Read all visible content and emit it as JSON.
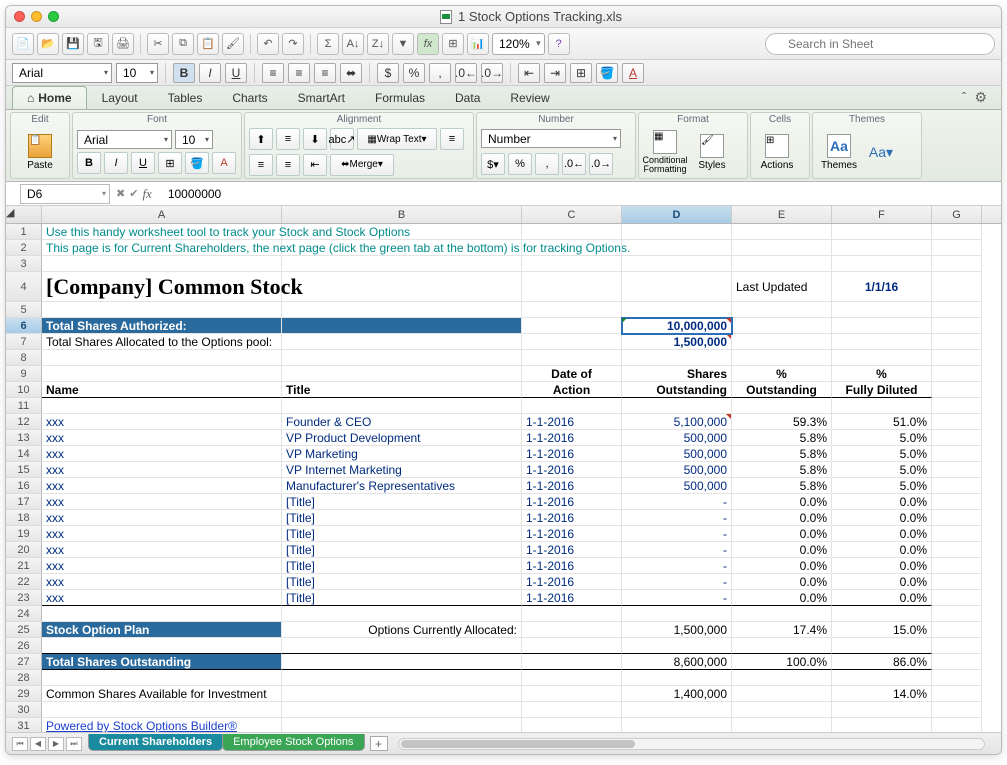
{
  "window_title": "1 Stock Options Tracking.xls",
  "zoom": "120%",
  "search_placeholder": "Search in Sheet",
  "font_name": "Arial",
  "font_size": "10",
  "ribbon_tabs": [
    "A Home",
    "Layout",
    "Tables",
    "Charts",
    "SmartArt",
    "Formulas",
    "Data",
    "Review"
  ],
  "ribbon_home_label": "Home",
  "groups": {
    "edit": "Edit",
    "font": "Font",
    "alignment": "Alignment",
    "number": "Number",
    "format": "Format",
    "cells": "Cells",
    "themes": "Themes"
  },
  "number_format": "Number",
  "wrap_text": "Wrap Text",
  "merge": "Merge",
  "cond_fmt": "Conditional Formatting",
  "styles": "Styles",
  "actions": "Actions",
  "themes": "Themes",
  "paste": "Paste",
  "name_box": "D6",
  "formula_value": "10000000",
  "columns": [
    "A",
    "B",
    "C",
    "D",
    "E",
    "F",
    "G"
  ],
  "row1": "Use this handy worksheet tool to track your Stock and Stock Options",
  "row2": "This page is for Current Shareholders, the next page (click the green tab at the bottom) is for tracking Options.",
  "title": "[Company] Common Stock",
  "last_updated_label": "Last Updated",
  "last_updated_value": "1/1/16",
  "total_auth_label": "Total Shares Authorized:",
  "total_auth_value": "10,000,000",
  "total_pool_label": "Total Shares Allocated to the Options pool:",
  "total_pool_value": "1,500,000",
  "hdr_name": "Name",
  "hdr_title": "Title",
  "hdr_date": "Date of Action",
  "hdr_shares": "Shares Outstanding",
  "hdr_pct_out": "% Outstanding",
  "hdr_pct_fd": "% Fully Diluted",
  "rows": [
    {
      "n": "xxx",
      "t": "Founder & CEO",
      "d": "1-1-2016",
      "s": "5,100,000",
      "po": "59.3%",
      "pf": "51.0%"
    },
    {
      "n": "xxx",
      "t": "VP Product Development",
      "d": "1-1-2016",
      "s": "500,000",
      "po": "5.8%",
      "pf": "5.0%"
    },
    {
      "n": "xxx",
      "t": "VP Marketing",
      "d": "1-1-2016",
      "s": "500,000",
      "po": "5.8%",
      "pf": "5.0%"
    },
    {
      "n": "xxx",
      "t": "VP Internet Marketing",
      "d": "1-1-2016",
      "s": "500,000",
      "po": "5.8%",
      "pf": "5.0%"
    },
    {
      "n": "xxx",
      "t": "Manufacturer's Representatives",
      "d": "1-1-2016",
      "s": "500,000",
      "po": "5.8%",
      "pf": "5.0%"
    },
    {
      "n": "xxx",
      "t": "[Title]",
      "d": "1-1-2016",
      "s": "-",
      "po": "0.0%",
      "pf": "0.0%"
    },
    {
      "n": "xxx",
      "t": "[Title]",
      "d": "1-1-2016",
      "s": "-",
      "po": "0.0%",
      "pf": "0.0%"
    },
    {
      "n": "xxx",
      "t": "[Title]",
      "d": "1-1-2016",
      "s": "-",
      "po": "0.0%",
      "pf": "0.0%"
    },
    {
      "n": "xxx",
      "t": "[Title]",
      "d": "1-1-2016",
      "s": "-",
      "po": "0.0%",
      "pf": "0.0%"
    },
    {
      "n": "xxx",
      "t": "[Title]",
      "d": "1-1-2016",
      "s": "-",
      "po": "0.0%",
      "pf": "0.0%"
    },
    {
      "n": "xxx",
      "t": "[Title]",
      "d": "1-1-2016",
      "s": "-",
      "po": "0.0%",
      "pf": "0.0%"
    },
    {
      "n": "xxx",
      "t": "[Title]",
      "d": "1-1-2016",
      "s": "-",
      "po": "0.0%",
      "pf": "0.0%"
    }
  ],
  "sop_label": "Stock Option Plan",
  "sop_sub": "Options Currently Allocated:",
  "sop_val": "1,500,000",
  "sop_po": "17.4%",
  "sop_pf": "15.0%",
  "tso_label": "Total Shares Outstanding",
  "tso_val": "8,600,000",
  "tso_po": "100.0%",
  "tso_pf": "86.0%",
  "avail_label": "Common Shares Available for Investment",
  "avail_val": "1,400,000",
  "avail_pf": "14.0%",
  "powered": "Powered by Stock Options Builder®",
  "sheet_tabs": {
    "active": "Current Shareholders",
    "green": "Employee Stock Options"
  }
}
